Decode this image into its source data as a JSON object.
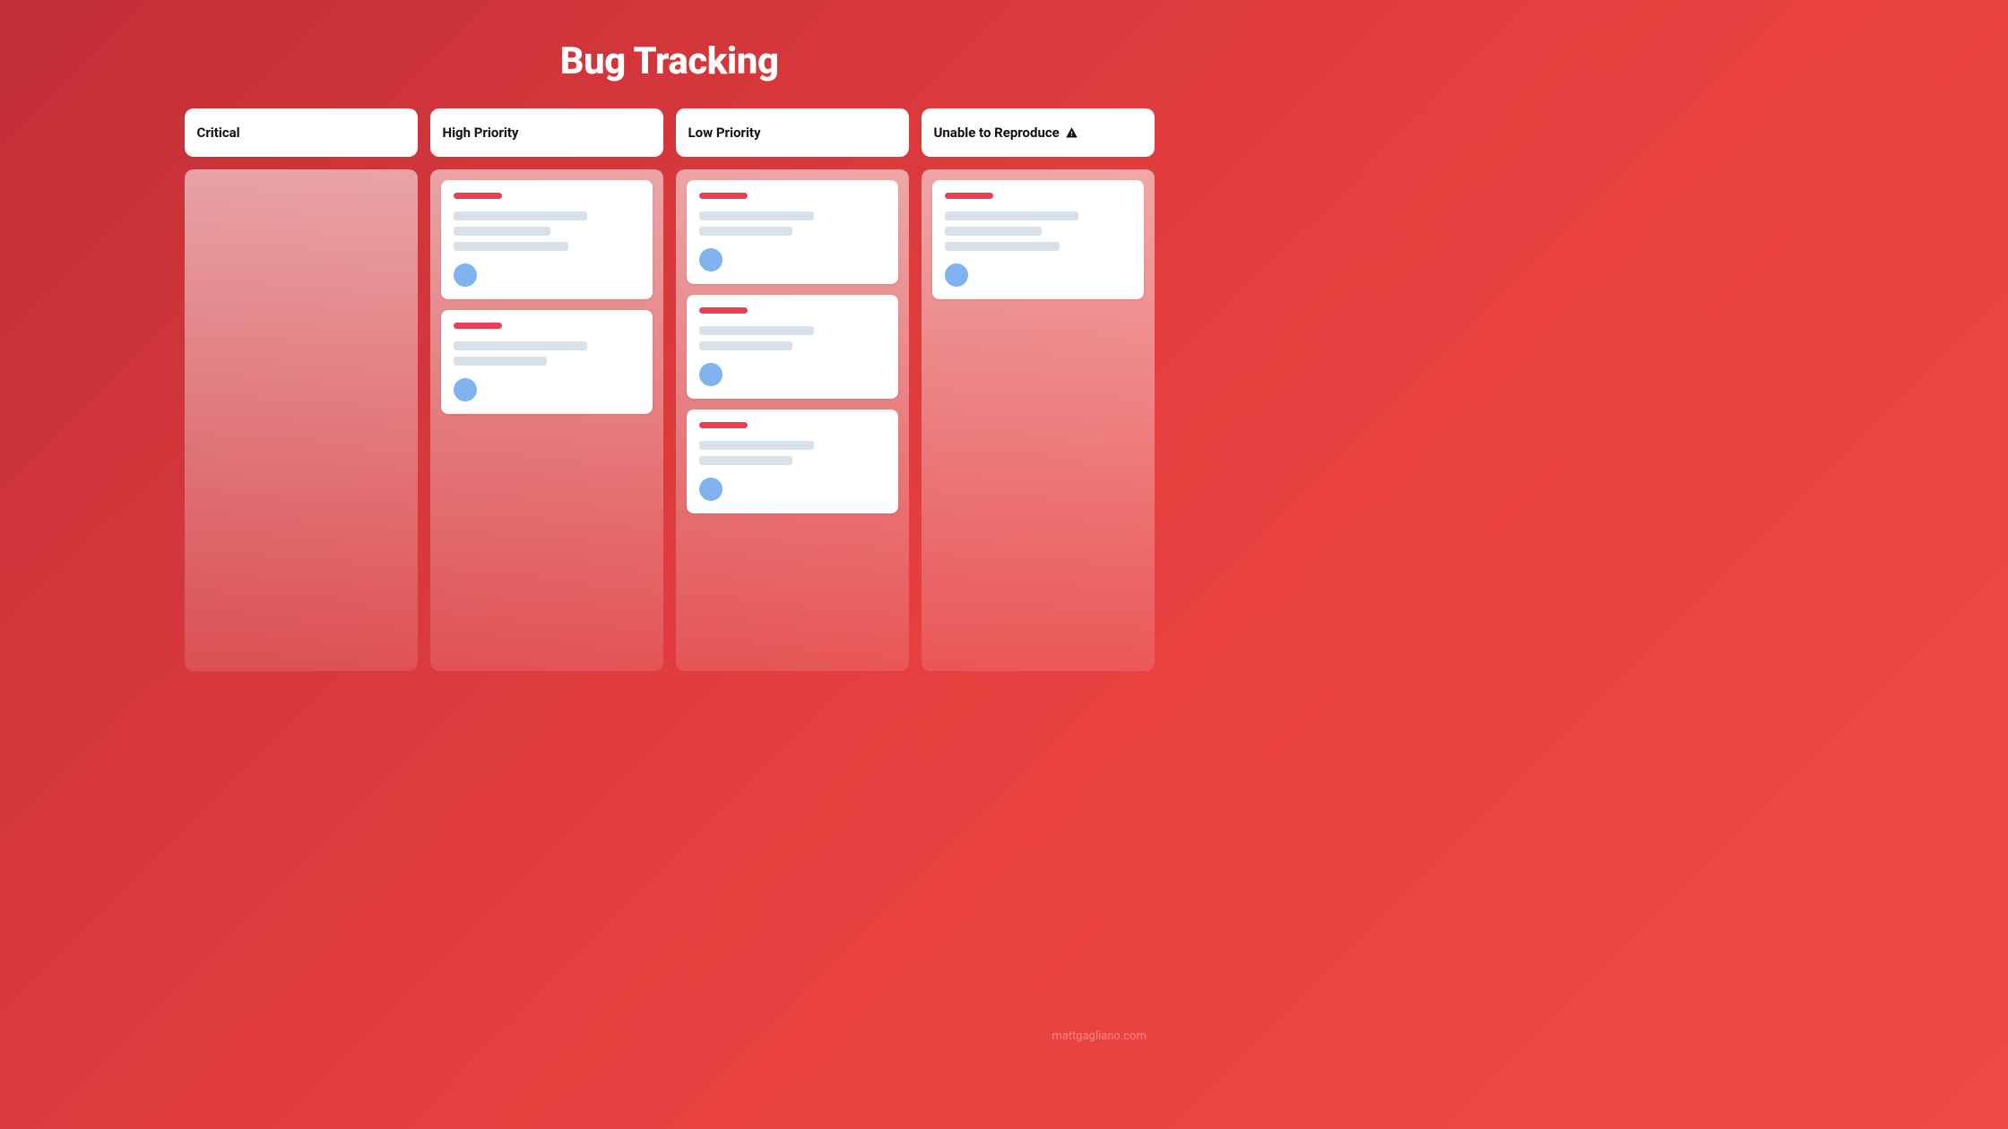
{
  "title": "Bug Tracking",
  "watermark": "mattgagliano.com",
  "columns": [
    {
      "id": "critical",
      "label": "Critical",
      "warning": false,
      "cards": []
    },
    {
      "id": "high",
      "label": "High Priority",
      "warning": false,
      "cards": [
        {
          "lines": [
            72,
            52,
            62
          ],
          "avatar": true
        },
        {
          "lines": [
            72,
            50
          ],
          "avatar": true
        }
      ]
    },
    {
      "id": "low",
      "label": "Low Priority",
      "warning": false,
      "cards": [
        {
          "lines": [
            62,
            50
          ],
          "avatar": true
        },
        {
          "lines": [
            62,
            50
          ],
          "avatar": true
        },
        {
          "lines": [
            62,
            50
          ],
          "avatar": true
        }
      ]
    },
    {
      "id": "unable",
      "label": "Unable to Reproduce",
      "warning": true,
      "cards": [
        {
          "lines": [
            72,
            52,
            62
          ],
          "avatar": true
        }
      ]
    }
  ]
}
